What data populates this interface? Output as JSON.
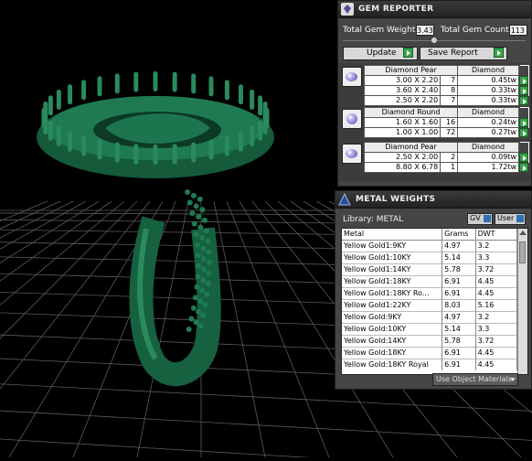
{
  "gem_reporter": {
    "title": "GEM REPORTER",
    "total_gem_weight_label": "Total Gem Weight",
    "total_gem_weight": "3.43",
    "total_gem_count_label": "Total Gem Count",
    "total_gem_count": "113",
    "update_label": "Update",
    "save_report_label": "Save Report",
    "groups": [
      {
        "shape": "Diamond Pear",
        "material": "Diamond",
        "rows": [
          {
            "size": "3.00 X 2.20",
            "count": "7",
            "weight": "0.45tw"
          },
          {
            "size": "3.60 X 2.40",
            "count": "8",
            "weight": "0.33tw"
          },
          {
            "size": "2.50 X 2.20",
            "count": "7",
            "weight": "0.33tw"
          }
        ]
      },
      {
        "shape": "Diamond Round",
        "material": "Diamond",
        "rows": [
          {
            "size": "1.60 X 1.60",
            "count": "16",
            "weight": "0.24tw"
          },
          {
            "size": "1.00 X 1.00",
            "count": "72",
            "weight": "0.27tw"
          }
        ]
      },
      {
        "shape": "Diamond Pear",
        "material": "Diamond",
        "rows": [
          {
            "size": "2.50 X 2.00",
            "count": "2",
            "weight": "0.09tw"
          },
          {
            "size": "8.80 X 6.78",
            "count": "1",
            "weight": "1.72tw"
          }
        ]
      }
    ]
  },
  "metal_weights": {
    "title": "METAL WEIGHTS",
    "library_label": "Library: METAL",
    "gv_label": "GV",
    "user_label": "User",
    "columns": [
      "Metal",
      "Grams",
      "DWT"
    ],
    "rows": [
      [
        "Yellow Gold1:9KY",
        "4.97",
        "3.2"
      ],
      [
        "Yellow Gold1:10KY",
        "5.14",
        "3.3"
      ],
      [
        "Yellow Gold1:14KY",
        "5.78",
        "3.72"
      ],
      [
        "Yellow Gold1:18KY",
        "6.91",
        "4.45"
      ],
      [
        "Yellow Gold1:18KY Ro...",
        "6.91",
        "4.45"
      ],
      [
        "Yellow Gold1:22KY",
        "8.03",
        "5.16"
      ],
      [
        "Yellow Gold:9KY",
        "4.97",
        "3.2"
      ],
      [
        "Yellow Gold:10KY",
        "5.14",
        "3.3"
      ],
      [
        "Yellow Gold:14KY",
        "5.78",
        "3.72"
      ],
      [
        "Yellow Gold:18KY",
        "6.91",
        "4.45"
      ],
      [
        "Yellow Gold:18KY Royal",
        "6.91",
        "4.45"
      ]
    ],
    "use_object_materials_label": "Use Object Materials"
  },
  "colors": {
    "model_green": "#1a6b47",
    "grid_line": "#5a5a5a",
    "panel_bg": "#454545",
    "play_green": "#3aa34b"
  }
}
